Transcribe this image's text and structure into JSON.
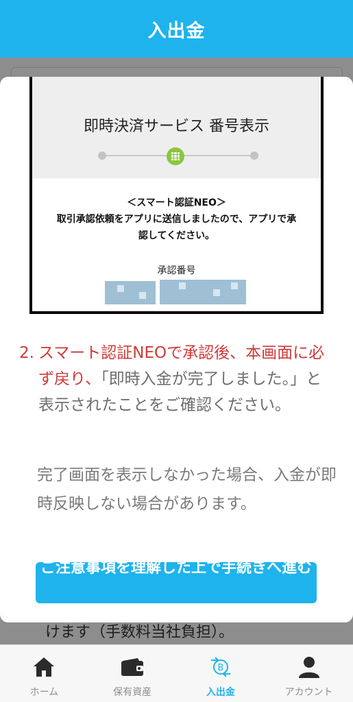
{
  "header": {
    "title": "入出金"
  },
  "background": {
    "visible_text": "けます（手数料当社負担）。"
  },
  "embedded_screenshot": {
    "title": "即時決済サービス 番号表示",
    "body_line1": "＜スマート認証NEO＞",
    "body_line2": "取引承認依頼をアプリに送信しましたので、アプリで承",
    "body_line3": "認してください。",
    "approval_label": "承認番号"
  },
  "modal": {
    "step_number": "2.",
    "instruction_red": "スマート認証NEOで承認後、本画面に必ず戻り、",
    "instruction_rest": "「即時入金が完了しました。」と表示されたことをご確認ください。",
    "note": "完了画面を表示しなかった場合、入金が即時反映しない場合があります。",
    "cta_label": "ご注意事項を理解した上で手続きへ進む"
  },
  "nav": {
    "items": [
      {
        "label": "ホーム",
        "icon": "home-icon"
      },
      {
        "label": "保有資産",
        "icon": "wallet-icon"
      },
      {
        "label": "入出金",
        "icon": "bitcoin-transfer-icon"
      },
      {
        "label": "アカウント",
        "icon": "person-icon"
      }
    ],
    "active_index": 2
  },
  "colors": {
    "brand": "#1eb3ec",
    "alert": "#d03a3a",
    "step_active": "#8cc63f"
  }
}
